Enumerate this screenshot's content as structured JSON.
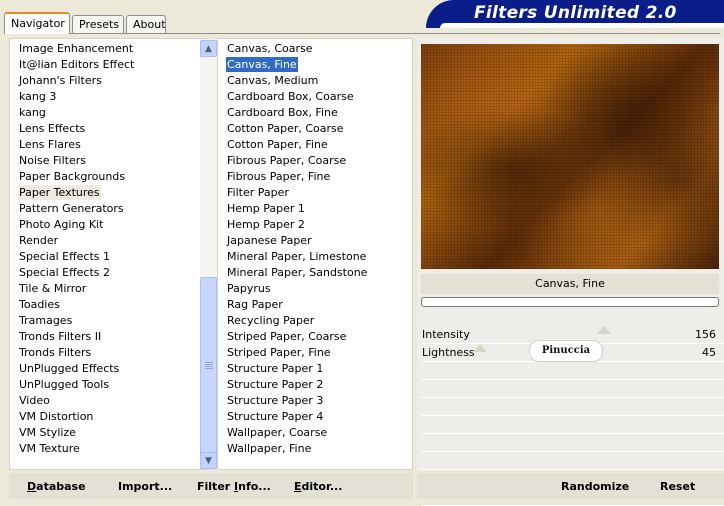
{
  "tabs": [
    "Navigator",
    "Presets",
    "About"
  ],
  "banner_title": "Filters Unlimited 2.0",
  "categories": [
    "Image Enhancement",
    "It@lian Editors Effect",
    "Johann's Filters",
    "kang 3",
    "kang",
    "Lens Effects",
    "Lens Flares",
    "Noise Filters",
    "Paper Backgrounds",
    "Paper Textures",
    "Pattern Generators",
    "Photo Aging Kit",
    "Render",
    "Special Effects 1",
    "Special Effects 2",
    "Tile & Mirror",
    "Toadies",
    "Tramages",
    "Tronds Filters II",
    "Tronds Filters",
    "UnPlugged Effects",
    "UnPlugged Tools",
    "Video",
    "VM Distortion",
    "VM Stylize",
    "VM Texture"
  ],
  "selected_category": "Paper Textures",
  "filters": [
    "Canvas, Coarse",
    "Canvas, Fine",
    "Canvas, Medium",
    "Cardboard Box, Coarse",
    "Cardboard Box, Fine",
    "Cotton Paper, Coarse",
    "Cotton Paper, Fine",
    "Fibrous Paper, Coarse",
    "Fibrous Paper, Fine",
    "Filter Paper",
    "Hemp Paper 1",
    "Hemp Paper 2",
    "Japanese Paper",
    "Mineral Paper, Limestone",
    "Mineral Paper, Sandstone",
    "Papyrus",
    "Rag Paper",
    "Recycling Paper",
    "Striped Paper, Coarse",
    "Striped Paper, Fine",
    "Structure Paper 1",
    "Structure Paper 2",
    "Structure Paper 3",
    "Structure Paper 4",
    "Wallpaper, Coarse",
    "Wallpaper, Fine"
  ],
  "selected_filter": "Canvas, Fine",
  "current_filter_name": "Canvas, Fine",
  "controls": [
    {
      "label": "Intensity",
      "value": "156",
      "level": 0.61
    },
    {
      "label": "Lightness",
      "value": "45",
      "level": 0.18
    }
  ],
  "watermark_text": "Pinuccia",
  "buttons": {
    "database": {
      "hot": "D",
      "rest": "atabase"
    },
    "import": {
      "pre": "Import",
      "hot": "",
      "post": "..."
    },
    "filter_info": {
      "pre": "Filter ",
      "hot": "I",
      "post": "nfo..."
    },
    "editor": {
      "hot": "E",
      "rest": "ditor..."
    },
    "randomize": "Randomize",
    "reset": "Reset"
  },
  "icons": {
    "scroll_up": "chevron-up-icon",
    "scroll_down": "chevron-down-icon"
  },
  "colors": {
    "banner": "#0a1e8a",
    "selection": "#316ac5",
    "tab_accent": "#e68b2c"
  }
}
